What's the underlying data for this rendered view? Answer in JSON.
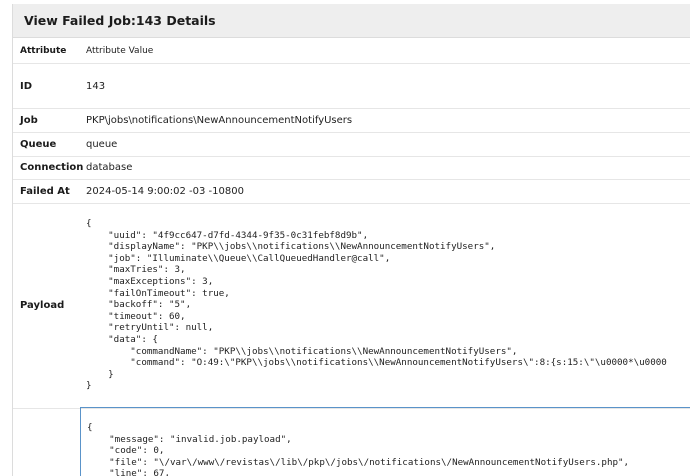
{
  "panel": {
    "title": "View Failed Job:143 Details"
  },
  "table": {
    "header": {
      "attribute": "Attribute",
      "value": "Attribute Value"
    },
    "rows": [
      {
        "label": "ID",
        "value": "143"
      },
      {
        "label": "Job",
        "value": "PKP\\jobs\\notifications\\NewAnnouncementNotifyUsers"
      },
      {
        "label": "Queue",
        "value": "queue"
      },
      {
        "label": "Connection",
        "value": "database"
      },
      {
        "label": "Failed At",
        "value": "2024-05-14 9:00:02 -03 -10800"
      }
    ],
    "payload": {
      "label": "Payload",
      "text": "{\n    \"uuid\": \"4f9cc647-d7fd-4344-9f35-0c31febf8d9b\",\n    \"displayName\": \"PKP\\\\jobs\\\\notifications\\\\NewAnnouncementNotifyUsers\",\n    \"job\": \"Illuminate\\\\Queue\\\\CallQueuedHandler@call\",\n    \"maxTries\": 3,\n    \"maxExceptions\": 3,\n    \"failOnTimeout\": true,\n    \"backoff\": \"5\",\n    \"timeout\": 60,\n    \"retryUntil\": null,\n    \"data\": {\n        \"commandName\": \"PKP\\\\jobs\\\\notifications\\\\NewAnnouncementNotifyUsers\",\n        \"command\": \"O:49:\\\"PKP\\\\jobs\\\\notifications\\\\NewAnnouncementNotifyUsers\\\":8:{s:15:\\\"\\u0000*\\u0000\n    }\n}"
    },
    "exception": {
      "text": "{\n    \"message\": \"invalid.job.payload\",\n    \"code\": 0,\n    \"file\": \"\\/var\\/www\\/revistas\\/lib\\/pkp\\/jobs\\/notifications\\/NewAnnouncementNotifyUsers.php\",\n    \"line\": 67,"
    }
  }
}
